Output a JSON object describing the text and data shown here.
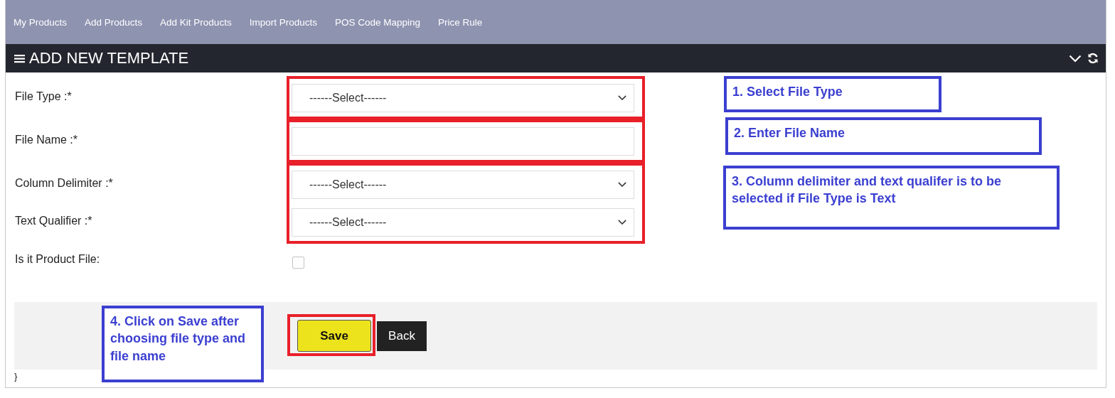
{
  "nav": {
    "items": [
      {
        "label": "My Products"
      },
      {
        "label": "Add Products"
      },
      {
        "label": "Add Kit Products"
      },
      {
        "label": "Import Products"
      },
      {
        "label": "POS Code Mapping"
      },
      {
        "label": "Price Rule"
      }
    ]
  },
  "panel": {
    "title": "ADD NEW TEMPLATE"
  },
  "form_groups": [
    {
      "highlighted": true,
      "callout": "1. Select File Type",
      "fields": [
        {
          "kind": "select",
          "label": "File Type :*",
          "value": "------Select------"
        }
      ]
    },
    {
      "highlighted": true,
      "callout": "2. Enter File Name",
      "fields": [
        {
          "kind": "text",
          "label": "File Name :*"
        }
      ]
    },
    {
      "highlighted": true,
      "callout": "3. Column delimiter and text qualifer is to be selected if File Type is Text",
      "fields": [
        {
          "kind": "select",
          "label": "Column Delimiter :*",
          "value": "------Select------"
        },
        {
          "kind": "select",
          "label": "Text Qualifier :*",
          "value": "------Select------"
        }
      ]
    },
    {
      "highlighted": false,
      "fields": [
        {
          "kind": "checkbox",
          "label": "Is it Product File:",
          "checked": false
        }
      ]
    }
  ],
  "footer": {
    "callout": "4. Click on Save after choosing file type and file name",
    "buttons": [
      {
        "kind": "primary",
        "label": "Save",
        "highlighted": true
      },
      {
        "kind": "dark",
        "label": "Back",
        "highlighted": false
      }
    ]
  },
  "trailing_text": "}"
}
